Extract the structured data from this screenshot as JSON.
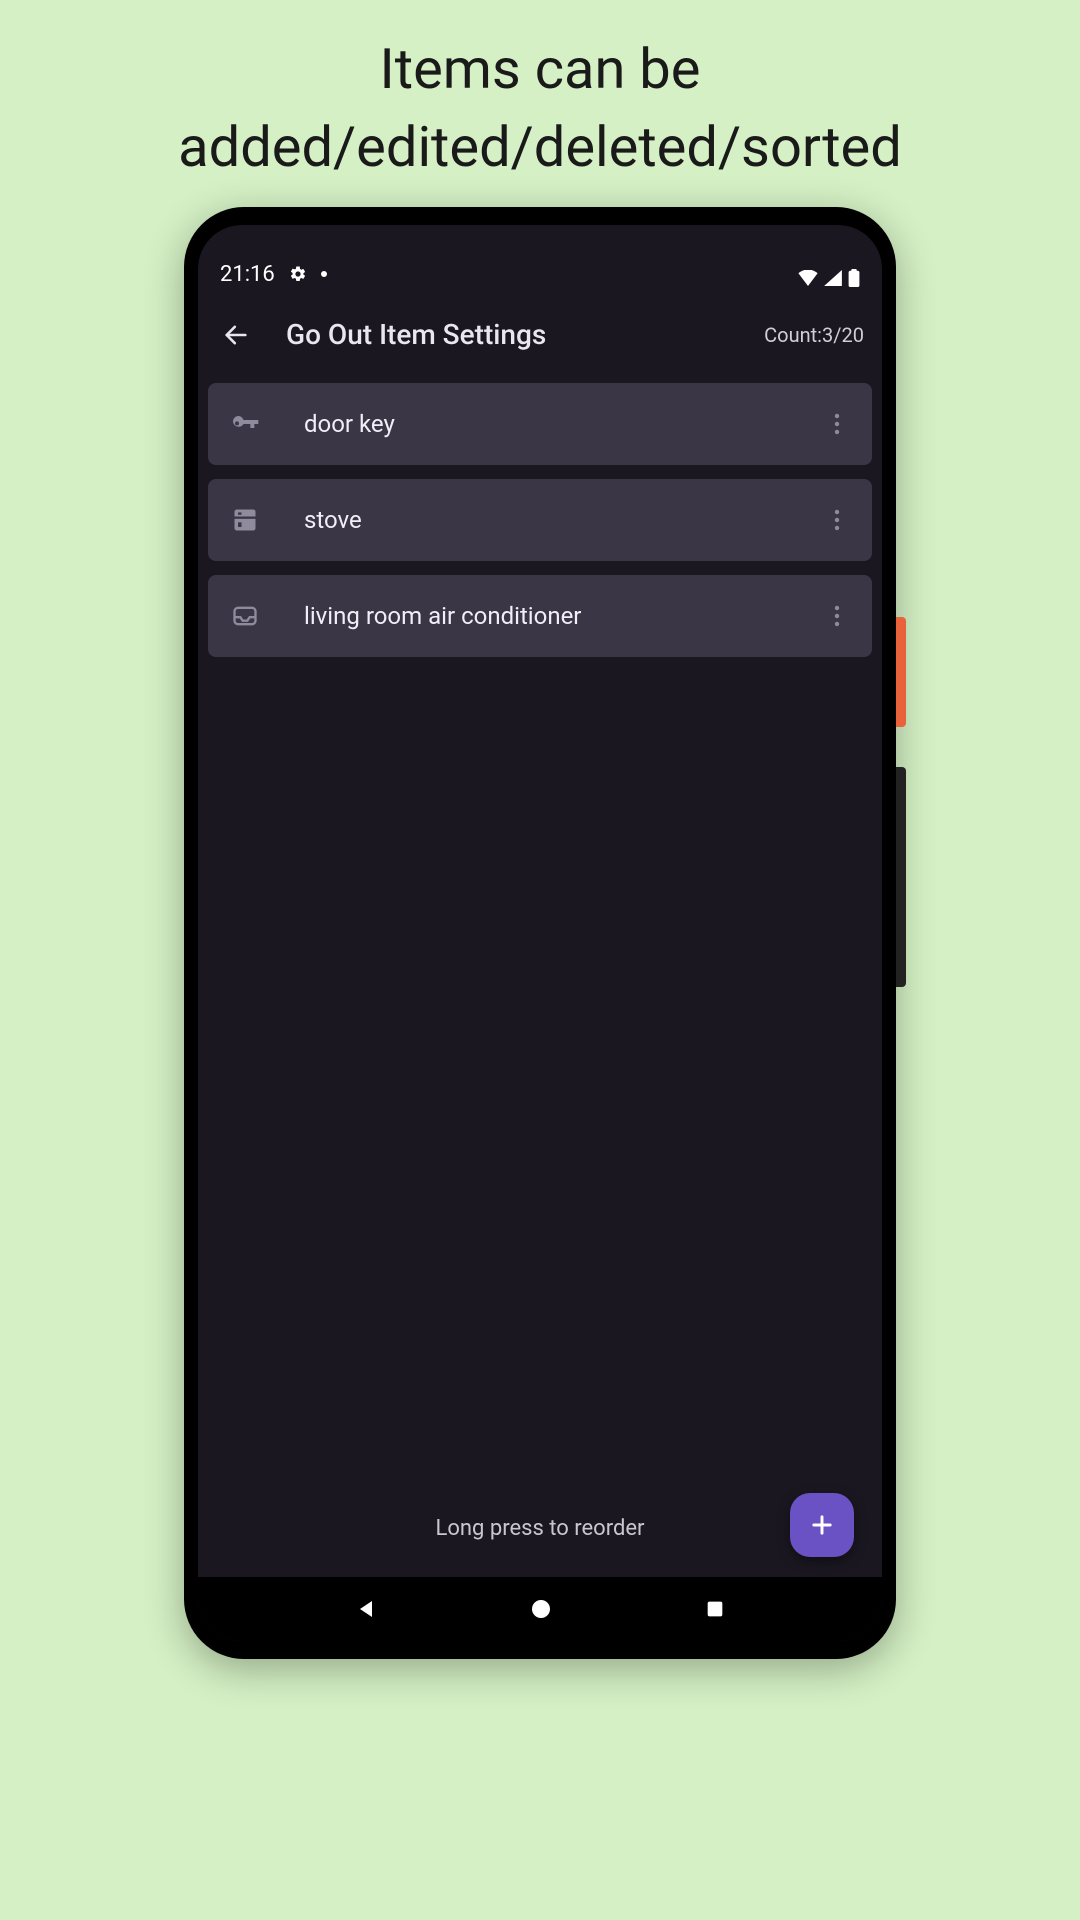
{
  "caption": {
    "line1": "Items can be",
    "line2": "added/edited/deleted/sorted"
  },
  "status": {
    "time": "21:16"
  },
  "appbar": {
    "title": "Go Out Item Settings",
    "count_label": "Count:3/20"
  },
  "items": [
    {
      "label": "door key",
      "icon": "key-icon"
    },
    {
      "label": "stove",
      "icon": "appliance-icon"
    },
    {
      "label": "living room air conditioner",
      "icon": "inbox-icon"
    }
  ],
  "footer": {
    "hint": "Long press to reorder"
  }
}
